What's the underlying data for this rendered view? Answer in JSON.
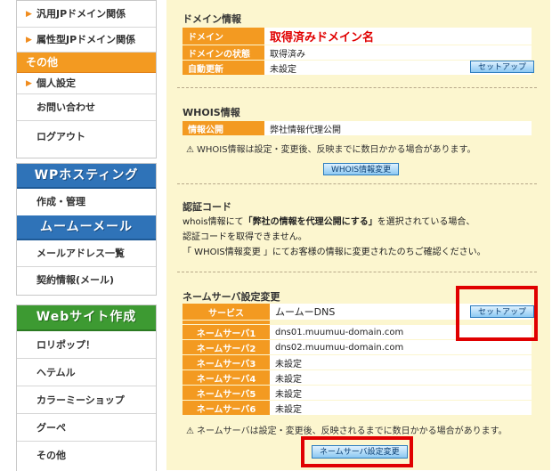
{
  "sidebar": {
    "menu1": {
      "items": [
        {
          "label": "汎用JPドメイン関係",
          "arrow": "▶"
        },
        {
          "label": "属性型JPドメイン関係",
          "arrow": "▶"
        }
      ],
      "section_title": "その他",
      "sub_items": [
        {
          "label": "個人設定",
          "arrow": "▶"
        },
        {
          "label": "お問い合わせ"
        },
        {
          "label": "ログアウト"
        }
      ]
    },
    "wp": {
      "title": "WPホスティング",
      "items": [
        {
          "label": "作成・管理"
        }
      ],
      "mail_title": "ムームーメール",
      "mail_items": [
        {
          "label": "メールアドレス一覧"
        },
        {
          "label": "契約情報(メール)"
        }
      ]
    },
    "web": {
      "title": "Webサイト作成",
      "items": [
        {
          "label": "ロリポップ！"
        },
        {
          "label": "ヘテムル"
        },
        {
          "label": "カラーミーショップ"
        },
        {
          "label": "グーペ"
        },
        {
          "label": "その他"
        }
      ]
    }
  },
  "domain_info": {
    "title": "ドメイン情報",
    "rows": [
      {
        "key": "ドメイン",
        "value": "取得済みドメイン名"
      },
      {
        "key": "ドメインの状態",
        "value": "取得済み"
      },
      {
        "key": "自動更新",
        "value": "未設定"
      }
    ],
    "setup_button": "セットアップ"
  },
  "whois": {
    "title": "WHOIS情報",
    "row": {
      "key": "情報公開",
      "value": "弊社情報代理公開"
    },
    "warning": "WHOIS情報は設定・変更後、反映までに数日かかる場合があります。",
    "button": "WHOIS情報変更"
  },
  "auth_code": {
    "title": "認証コード",
    "line1_pre": "whois情報にて",
    "line1_bold": "「弊社の情報を代理公開にする」",
    "line1_post": "を選択されている場合、",
    "line2": "認証コードを取得できません。",
    "line3": "「 WHOIS情報変更 」にてお客様の情報に変更されたのちご確認ください。"
  },
  "nameserver": {
    "title": "ネームサーバ設定変更",
    "service_row": {
      "key": "サービス",
      "value": "ムームーDNS"
    },
    "setup_button": "セットアップ",
    "servers": [
      {
        "key": "ネームサーバ1",
        "value": "dns01.muumuu-domain.com"
      },
      {
        "key": "ネームサーバ2",
        "value": "dns02.muumuu-domain.com"
      },
      {
        "key": "ネームサーバ3",
        "value": "未設定"
      },
      {
        "key": "ネームサーバ4",
        "value": "未設定"
      },
      {
        "key": "ネームサーバ5",
        "value": "未設定"
      },
      {
        "key": "ネームサーバ6",
        "value": "未設定"
      }
    ],
    "warning": "ネームサーバは設定・変更後、反映されるまでに数日かかる場合があります。",
    "change_button": "ネームサーバ設定変更"
  },
  "colors": {
    "accent_orange": "#f39a21",
    "panel_bg": "#fcf6cf",
    "highlight_red": "#e00000",
    "wp_blue": "#2f73b8",
    "web_green": "#3d9a32"
  }
}
